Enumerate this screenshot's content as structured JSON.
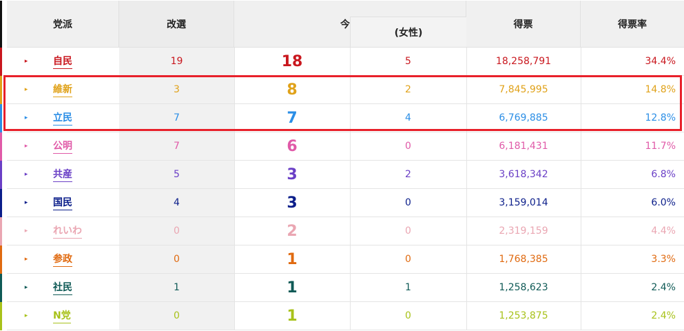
{
  "header": {
    "party": "党派",
    "kaisen": "改選",
    "konkai": "今回",
    "female": "(女性)",
    "votes": "得票",
    "rate": "得票率"
  },
  "rows": [
    {
      "name": "自民",
      "kaisen": "19",
      "konkai": "18",
      "female": "5",
      "votes": "18,258,791",
      "rate": "34.4%",
      "color": "#c9171e",
      "bar": "#c9171e",
      "arrow": "▸"
    },
    {
      "name": "維新",
      "kaisen": "3",
      "konkai": "8",
      "female": "2",
      "votes": "7,845,995",
      "rate": "14.8%",
      "color": "#e0a21a",
      "bar": "#e0a21a",
      "arrow": "▸"
    },
    {
      "name": "立民",
      "kaisen": "7",
      "konkai": "7",
      "female": "4",
      "votes": "6,769,885",
      "rate": "12.8%",
      "color": "#2b8ee6",
      "bar": "#2b8ee6",
      "arrow": "▸"
    },
    {
      "name": "公明",
      "kaisen": "7",
      "konkai": "6",
      "female": "0",
      "votes": "6,181,431",
      "rate": "11.7%",
      "color": "#e05aa8",
      "bar": "#e05aa8",
      "arrow": "▸"
    },
    {
      "name": "共産",
      "kaisen": "5",
      "konkai": "3",
      "female": "2",
      "votes": "3,618,342",
      "rate": "6.8%",
      "color": "#6a3fc6",
      "bar": "#6a3fc6",
      "arrow": "▸"
    },
    {
      "name": "国民",
      "kaisen": "4",
      "konkai": "3",
      "female": "0",
      "votes": "3,159,014",
      "rate": "6.0%",
      "color": "#0b1e8a",
      "bar": "#0b1e8a",
      "arrow": "▸"
    },
    {
      "name": "れいわ",
      "kaisen": "0",
      "konkai": "2",
      "female": "0",
      "votes": "2,319,159",
      "rate": "4.4%",
      "color": "#eaa6b2",
      "bar": "#eaa6b2",
      "arrow": "▸"
    },
    {
      "name": "参政",
      "kaisen": "0",
      "konkai": "1",
      "female": "0",
      "votes": "1,768,385",
      "rate": "3.3%",
      "color": "#e06a10",
      "bar": "#e06a10",
      "arrow": "▸"
    },
    {
      "name": "社民",
      "kaisen": "1",
      "konkai": "1",
      "female": "1",
      "votes": "1,258,623",
      "rate": "2.4%",
      "color": "#0f5a56",
      "bar": "#0f5a56",
      "arrow": "▸"
    },
    {
      "name": "N党",
      "kaisen": "0",
      "konkai": "1",
      "female": "0",
      "votes": "1,253,875",
      "rate": "2.4%",
      "color": "#a8c21a",
      "bar": "#a8c21a",
      "arrow": "▸"
    }
  ]
}
